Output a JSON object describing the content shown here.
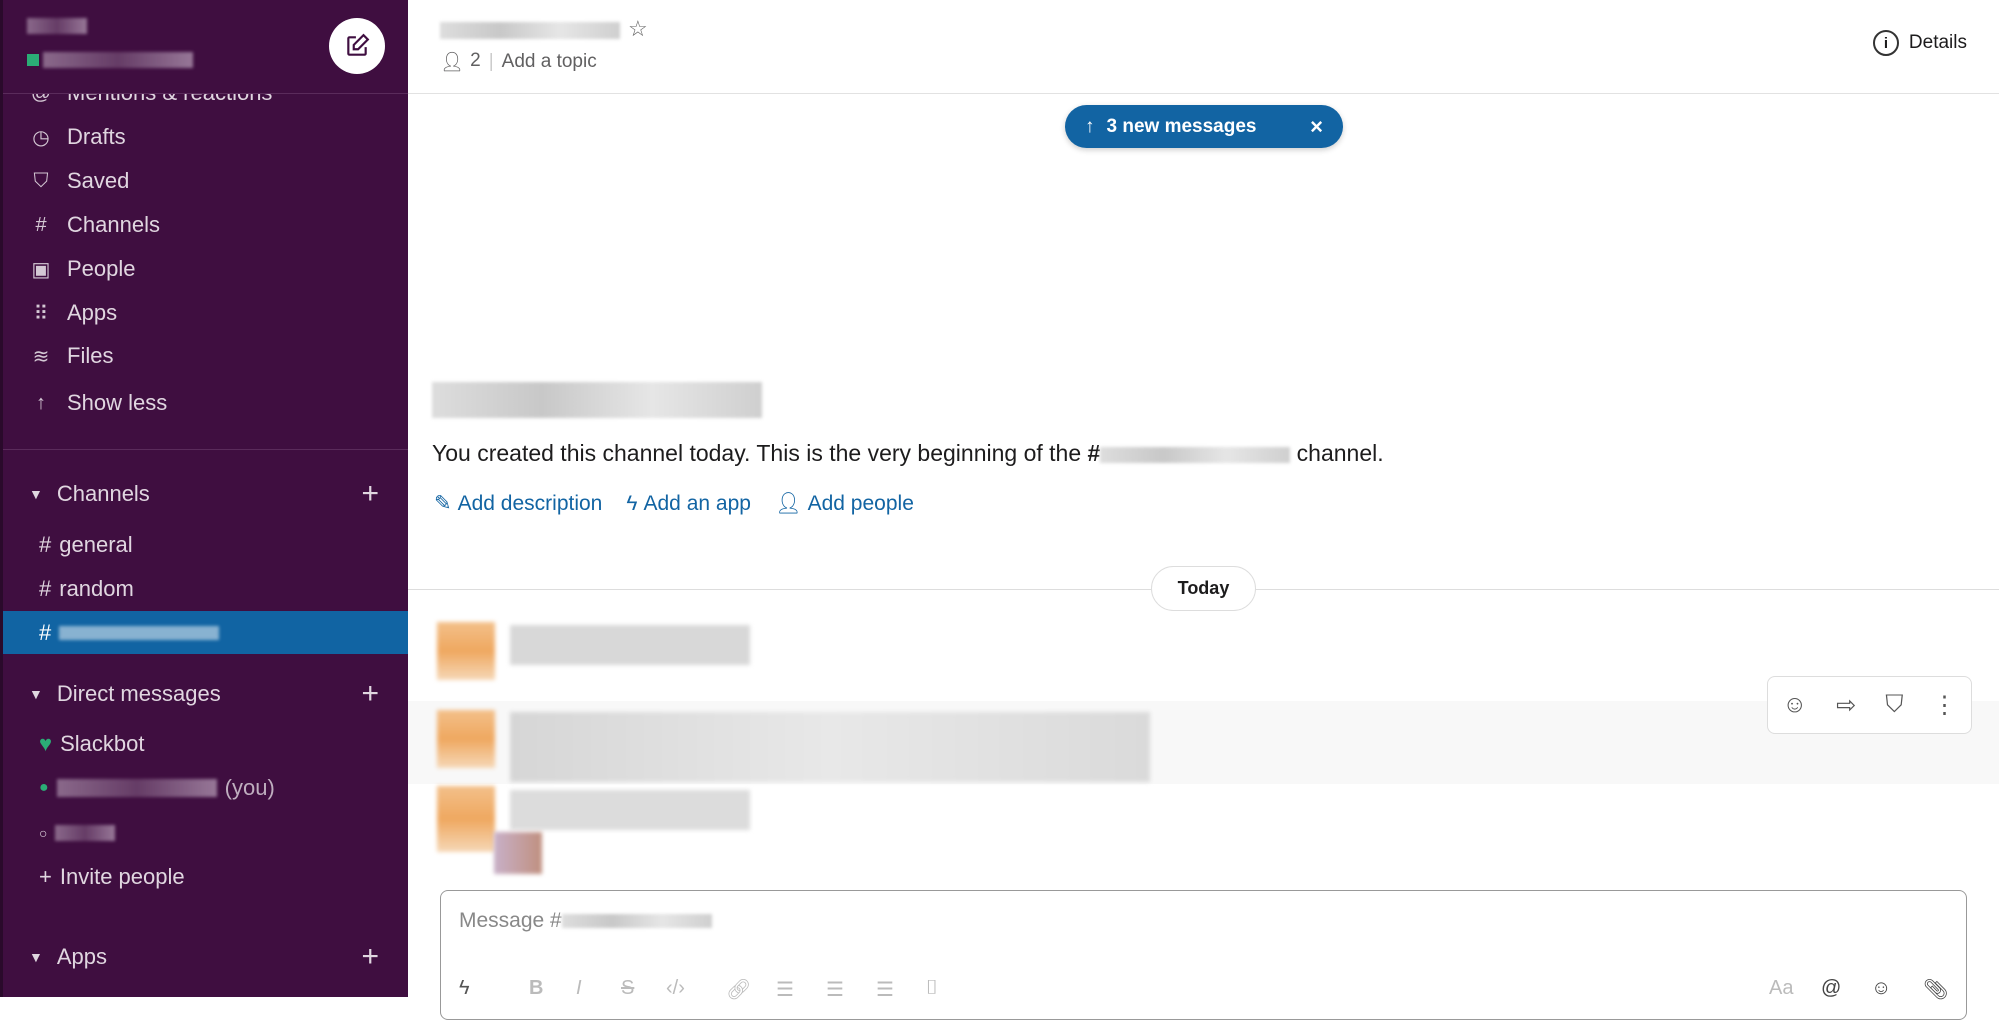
{
  "sidebar": {
    "nav_items": [
      {
        "label": "Mentions & reactions",
        "icon": "at-icon"
      },
      {
        "label": "Drafts",
        "icon": "drafts-icon"
      },
      {
        "label": "Saved",
        "icon": "bookmark-icon"
      },
      {
        "label": "Channels",
        "icon": "channel-search-icon"
      },
      {
        "label": "People",
        "icon": "people-icon"
      },
      {
        "label": "Apps",
        "icon": "apps-grid-icon"
      },
      {
        "label": "Files",
        "icon": "layers-icon"
      },
      {
        "label": "Show less",
        "icon": "arrow-up-icon"
      }
    ],
    "channels_header": "Channels",
    "channels": [
      {
        "prefix": "#",
        "name": "general"
      },
      {
        "prefix": "#",
        "name": "random"
      },
      {
        "prefix": "#",
        "name": ""
      }
    ],
    "dm_header": "Direct messages",
    "dms": [
      {
        "name": "Slackbot",
        "status_icon": "heart-icon"
      },
      {
        "suffix": "(you)",
        "status_icon": "online-dot-icon"
      },
      {
        "status_icon": "offline-dot-icon"
      }
    ],
    "invite": "Invite people",
    "apps_header": "Apps",
    "plus": "+"
  },
  "header": {
    "member_count": "2",
    "topic": "Add a topic",
    "details": "Details"
  },
  "banner": {
    "text": "3 new messages",
    "close": "×"
  },
  "intro": {
    "text_before": "You created this channel today. This is the very beginning of the ",
    "hash": "#",
    "text_after": " channel.",
    "links": [
      "Add description",
      "Add an app",
      "Add people"
    ]
  },
  "divider": {
    "label": "Today"
  },
  "composer": {
    "placeholder": "Message #",
    "format_label": "Aa"
  },
  "colors": {
    "sidebar": "#3f0e40",
    "selected": "#1164a3",
    "link": "#1264a3"
  }
}
